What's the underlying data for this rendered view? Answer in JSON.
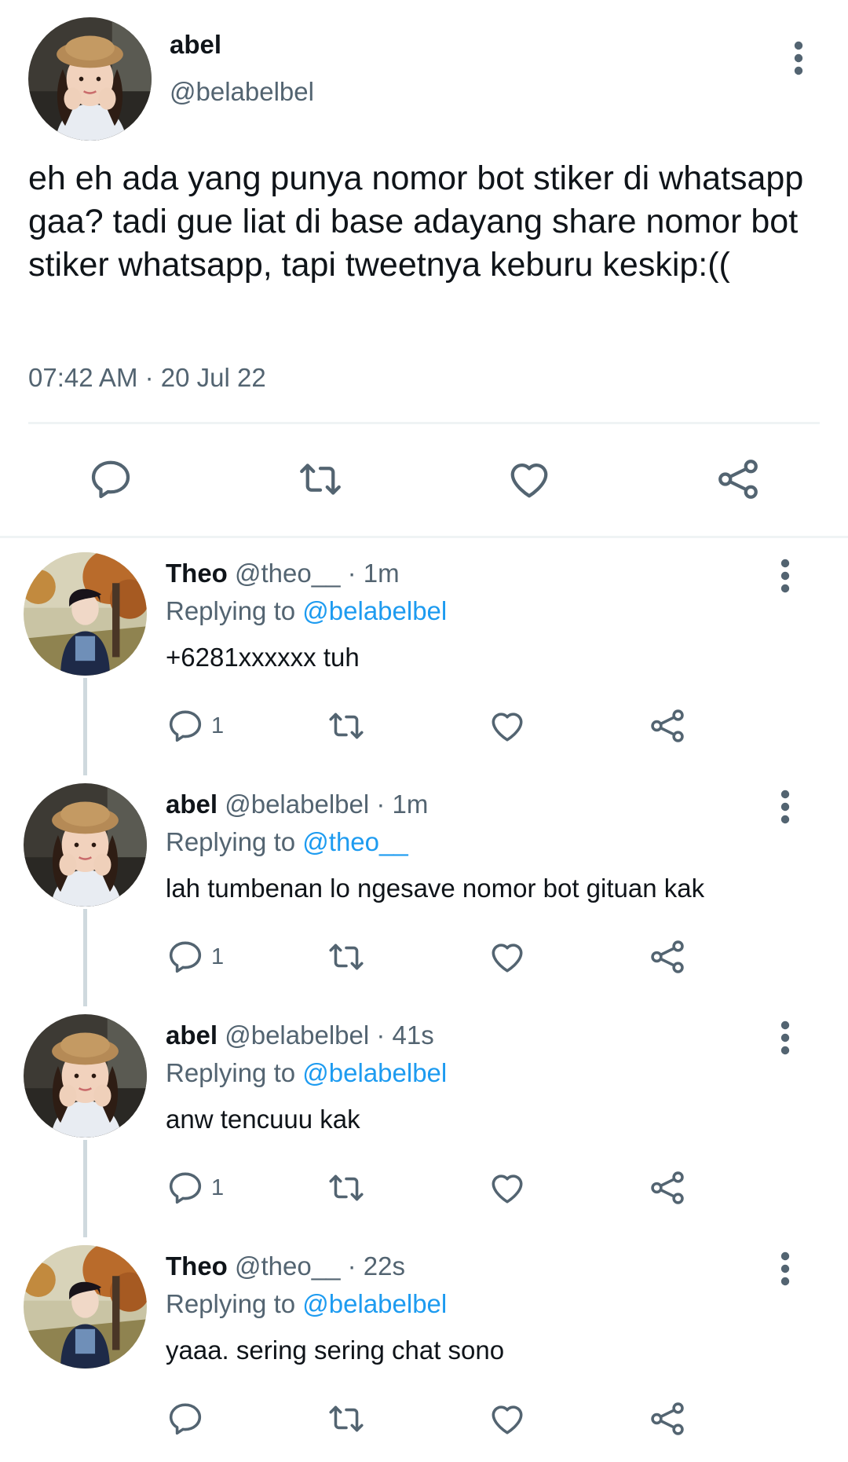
{
  "colors": {
    "text": "#0f1419",
    "secondary": "#536471",
    "link": "#1d9bf0",
    "divider": "#eff3f4",
    "thread_line": "#cfd9de"
  },
  "main_tweet": {
    "name": "abel",
    "handle": "@belabelbel",
    "text": "eh eh ada yang punya nomor bot stiker di whatsapp gaa? tadi gue liat di base adayang share nomor bot stiker whatsapp, tapi tweetnya keburu keskip:((",
    "timestamp": "07:42 AM · 20 Jul 22",
    "actions": [
      "reply-icon",
      "retweet-icon",
      "like-icon",
      "share-icon"
    ]
  },
  "replying_label": "Replying to",
  "replies": [
    {
      "name": "Theo",
      "meta": "@theo__ · 1m",
      "replying_to": "@belabelbel",
      "text": "+6281xxxxxx tuh",
      "reply_count": "1"
    },
    {
      "name": "abel",
      "meta": "@belabelbel · 1m",
      "replying_to": "@theo__",
      "text": "lah tumbenan lo ngesave nomor bot gituan kak",
      "reply_count": "1"
    },
    {
      "name": "abel",
      "meta": "@belabelbel · 41s",
      "replying_to": "@belabelbel",
      "text": "anw tencuuu kak",
      "reply_count": "1"
    },
    {
      "name": "Theo",
      "meta": "@theo__ · 22s",
      "replying_to": "@belabelbel",
      "text": "yaaa. sering sering chat sono",
      "reply_count": ""
    }
  ]
}
